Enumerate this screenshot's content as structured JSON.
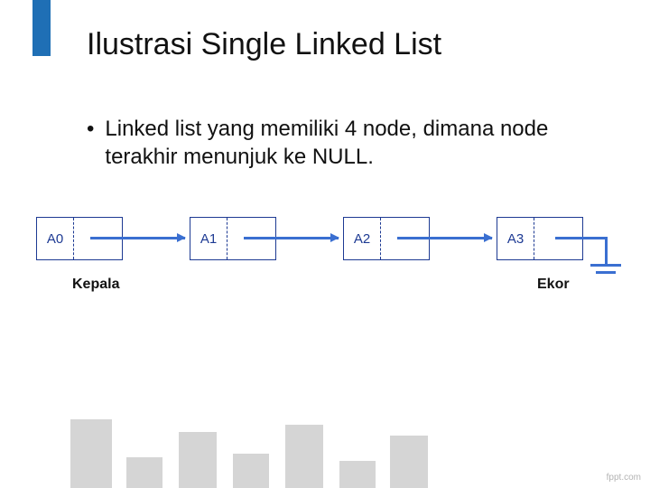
{
  "title": "Ilustrasi Single Linked List",
  "bullet": {
    "dot": "•",
    "text": "Linked list yang memiliki 4 node, dimana node terakhir menunjuk ke NULL."
  },
  "nodes": {
    "n0": "A0",
    "n1": "A1",
    "n2": "A2",
    "n3": "A3"
  },
  "labels": {
    "head": "Kepala",
    "tail": "Ekor"
  },
  "footer": "fppt.com",
  "chart_data": {
    "type": "diagram",
    "structure": "singly-linked-list",
    "nodes": [
      "A0",
      "A1",
      "A2",
      "A3"
    ],
    "edges": [
      {
        "from": "A0",
        "to": "A1"
      },
      {
        "from": "A1",
        "to": "A2"
      },
      {
        "from": "A2",
        "to": "A3"
      },
      {
        "from": "A3",
        "to": "NULL"
      }
    ],
    "head_label": "Kepala",
    "tail_label": "Ekor",
    "title": "Ilustrasi Single Linked List"
  }
}
